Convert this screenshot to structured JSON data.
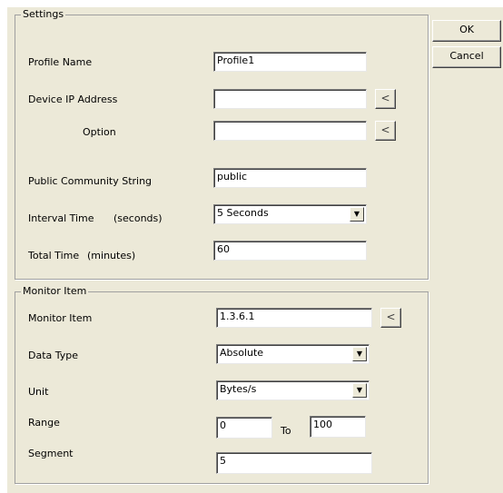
{
  "buttons": {
    "ok": "OK",
    "cancel": "Cancel",
    "pick": "<"
  },
  "settings": {
    "title": "Settings",
    "profile_name": {
      "label": "Profile Name",
      "value": "Profile1"
    },
    "device_ip": {
      "label": "Device IP Address",
      "value": ""
    },
    "option": {
      "label": "Option",
      "value": ""
    },
    "community": {
      "label": "Public Community String",
      "value": "public"
    },
    "interval": {
      "label": "Interval Time",
      "unit": "(seconds)",
      "value": "5 Seconds"
    },
    "total": {
      "label": "Total Time",
      "unit": "(minutes)",
      "value": "60"
    }
  },
  "monitor": {
    "title": "Monitor Item",
    "item": {
      "label": "Monitor Item",
      "value": "1.3.6.1"
    },
    "data_type": {
      "label": "Data Type",
      "value": "Absolute"
    },
    "unit": {
      "label": "Unit",
      "value": "Bytes/s"
    },
    "range": {
      "label": "Range",
      "from": "0",
      "to_label": "To",
      "to": "100"
    },
    "segment": {
      "label": "Segment",
      "value": "5"
    }
  },
  "icons": {
    "combo_arrow": "triangle-down"
  }
}
